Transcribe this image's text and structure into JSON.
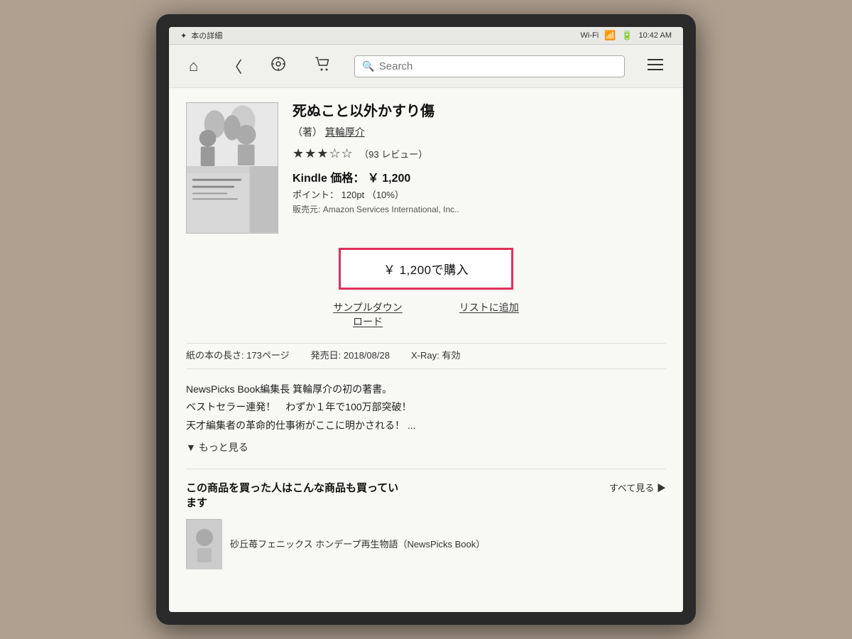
{
  "device": {
    "status_bar": {
      "app_name": "本の詳細",
      "wifi_label": "Wi-Fi",
      "time": "10:42 AM"
    },
    "nav": {
      "home_icon": "⌂",
      "back_icon": "〈",
      "discover_icon": "♡",
      "cart_icon": "🛒",
      "search_placeholder": "Search",
      "menu_icon": "≡"
    }
  },
  "book": {
    "title": "死ぬこと以外かすり傷",
    "author_prefix": "（著）",
    "author": "箕輪厚介",
    "rating_stars": "★★★☆☆",
    "rating_count": "（93 レビュー）",
    "kindle_price_label": "Kindle 価格：",
    "kindle_price_value": "￥ 1,200",
    "points_label": "ポイント：",
    "points_value": "120pt",
    "points_pct": "（10%）",
    "seller_label": "販売元:",
    "seller_name": "Amazon Services International, Inc..",
    "buy_button_label": "￥ 1,200で購入",
    "sample_download": "サンプルダウン\nロード",
    "add_to_list": "リストに追加",
    "pages_label": "紙の本の長さ: 173ページ",
    "release_label": "発売日: 2018/08/28",
    "xray_label": "X-Ray:",
    "xray_value": "有効",
    "description_line1": "NewsPicks Book編集長 箕輪厚介の初の著書。",
    "description_line2": "ベストセラー連発！　わずか１年で100万部突破！",
    "description_line3": "天才編集者の革命的仕事術がここに明かされる！ ...",
    "more_link": "▼ もっと見る",
    "also_bought_title": "この商品を買った人はこんな商品も買ってい\nます",
    "see_all": "すべて見る ▶",
    "related_book_title": "砂丘苺フェニックス ホンデープ再生物語（NewsPicks Book）"
  }
}
